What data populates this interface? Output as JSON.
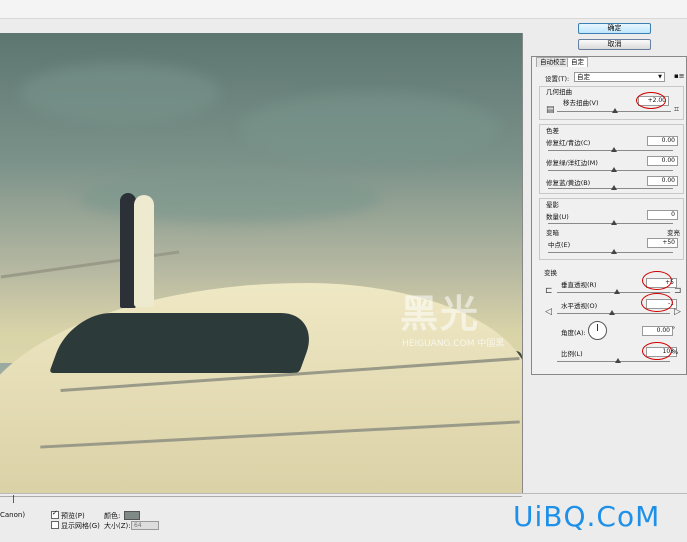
{
  "buttons": {
    "ok": "确定",
    "cancel": "取消"
  },
  "tabs": [
    {
      "label": "自动校正",
      "active": false
    },
    {
      "label": "自定",
      "active": true
    }
  ],
  "settings": {
    "label": "设置(T):",
    "value": "自定"
  },
  "geometric": {
    "title": "几何扭曲",
    "distort_label": "移去扭曲(V)",
    "distort_value": "+2.00"
  },
  "chromatic": {
    "title": "色差",
    "red_cyan_label": "修复红/青边(C)",
    "red_cyan_value": "0.00",
    "green_magenta_label": "修复绿/洋红边(M)",
    "green_magenta_value": "0.00",
    "blue_yellow_label": "修复蓝/黄边(B)",
    "blue_yellow_value": "0.00"
  },
  "vignette": {
    "title": "晕影",
    "amount_label": "数量(U)",
    "amount_value": "0",
    "darken_label": "变暗",
    "lighten_label": "变亮",
    "midpoint_label": "中点(E)",
    "midpoint_value": "+50"
  },
  "transform": {
    "title": "变换",
    "vertical_label": "垂直透视(R)",
    "vertical_value": "+5",
    "horizontal_label": "水平透视(O)",
    "horizontal_value": "-1",
    "angle_label": "角度(A):",
    "angle_value": "0.00",
    "angle_unit": "°",
    "scale_label": "比例(L)",
    "scale_value": "103",
    "scale_unit": "%"
  },
  "bottom": {
    "preview_label": "预览(P)",
    "preview_checked": true,
    "grid_label": "显示网格(G)",
    "grid_checked": false,
    "color_label": "颜色:",
    "size_label": "大小(Z):",
    "size_value": "64",
    "left_text": "Canon)"
  },
  "watermark": {
    "big": "黑光",
    "small": "HEIGUANG.COM 中国黑"
  },
  "brand": "UiBQ.CoM",
  "colors": {
    "highlight_circle": "#d00000",
    "brand": "#1e90e8",
    "ok_button": "#bee6fd"
  }
}
